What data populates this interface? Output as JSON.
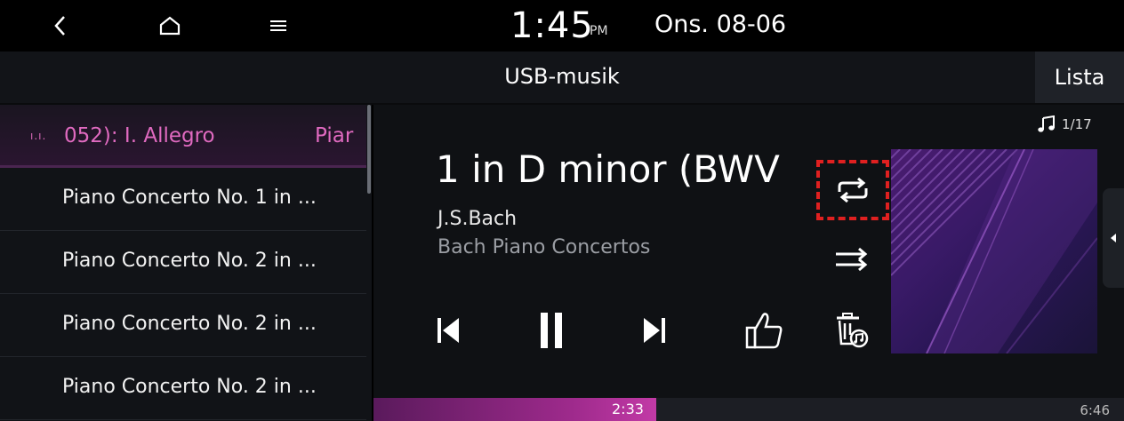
{
  "status_bar": {
    "time": "1:45",
    "ampm": "PM",
    "date": "Ons. 08-06",
    "icons": [
      "back-icon",
      "home-icon",
      "menu-icon"
    ]
  },
  "header": {
    "title": "USB-musik",
    "list_button": "Lista"
  },
  "playlist": {
    "now_playing": {
      "indicator": "ı.ı.",
      "title": "052): I. Allegro",
      "artist": "Piar"
    },
    "items": [
      {
        "label": "Piano Concerto No. 1 in ..."
      },
      {
        "label": "Piano Concerto No. 2 in ..."
      },
      {
        "label": "Piano Concerto No. 2 in ..."
      },
      {
        "label": "Piano Concerto No. 2 in ..."
      }
    ]
  },
  "player": {
    "track_count": "1/17",
    "song_title": "1 in D minor (BWV",
    "artist": "J.S.Bach",
    "album": "Bach Piano Concertos",
    "elapsed": "2:33",
    "total": "6:46",
    "progress_fraction": 0.377
  },
  "colors": {
    "accent": "#e06ac0",
    "highlight_box": "#e02020",
    "background": "#0f1114"
  }
}
